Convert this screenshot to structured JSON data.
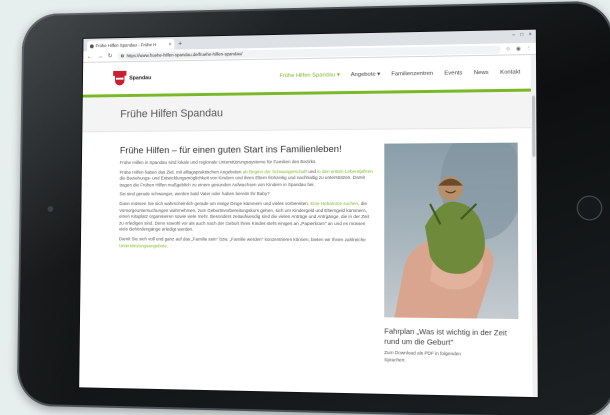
{
  "browser": {
    "tab_title": "Frühe Hilfen Spandau - Frühe H",
    "tab_close": "×",
    "new_tab": "+",
    "url": "https://www.fruehe-hilfen-spandau.de/fruehe-hilfen-spandau/",
    "window_controls": [
      "–",
      "□",
      "×"
    ]
  },
  "site": {
    "logo_name": "Spandau",
    "menu": [
      {
        "label": "Frühe Hilfen Spandau ▾",
        "active": true
      },
      {
        "label": "Angebote ▾",
        "active": false
      },
      {
        "label": "Familienzentren",
        "active": false
      },
      {
        "label": "Events",
        "active": false
      },
      {
        "label": "News",
        "active": false
      },
      {
        "label": "Kontakt",
        "active": false
      }
    ],
    "accent_color": "#79b928"
  },
  "page": {
    "title": "Frühe Hilfen Spandau",
    "heading": "Frühe Hilfen – für einen guten Start ins Familienleben!",
    "p1": "Frühe Hilfen in Spandau sind lokale und regionale Unterstützungssysteme für Familien des Bezirks.",
    "p2_a": "Frühe Hilfen haben das Ziel, mit alltagspraktischen Angeboten ",
    "p2_link1": "ab Beginn der Schwangerschaft",
    "p2_b": " und ",
    "p2_link2": "in den ersten Lebensjahren",
    "p2_c": " die Beziehungs- und Entwicklungsmöglichkeit von Kindern und ihren Eltern frühzeitig und nachhaltig zu unterstützen. Damit tragen die Frühen Hilfen maßgeblich zu einem gesunden Aufwachsen von Kindern in Spandau bei.",
    "p3": "Sie sind gerade schwanger, werden bald Vater oder haben bereits Ihr Baby?",
    "p4_a": "Dann müssen Sie sich wahrscheinlich gerade um einige Dinge kümmern und vieles vorbereiten. ",
    "p4_link": "Eine Hebamme suchen",
    "p4_b": ", die Vorsorgeuntersuchungen wahrnehmen, zum Geburtsvorbereitungskurs gehen, sich um Kindergeld und Elterngeld kümmern, einen Kitaplatz organisieren sowie viele mehr. Besonders zeitaufwendig sind die vielen Anträge und Antrgänge, die in der Zeit zu erledigen sind. Denn sowohl vor als auch nach der Geburt Ihres Kindes steht einiges an „Papierkram\" an und es müssen viele Behördengänge erledigt werden.",
    "p5_a": "Damit Sie sich voll und ganz auf das „Familie sein\" bzw. „Familie werden\" konzentrieren können, bieten wir Ihnen zahlreiche ",
    "p5_link": "Unterstützungsangebote",
    "p5_b": "."
  },
  "sidebar": {
    "heading": "Fahrplan „Was ist wichtig in der Zeit rund um die Geburt\"",
    "text": "Zum Download als PDF in folgenden Sprachen:"
  }
}
